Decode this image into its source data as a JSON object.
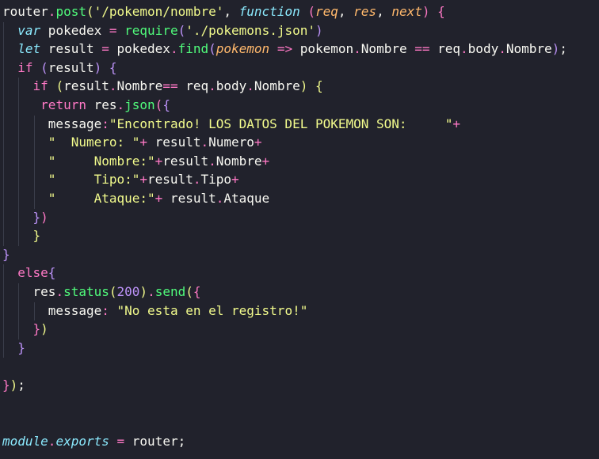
{
  "editor": {
    "lines": [
      {
        "segments": [
          {
            "t": "router",
            "c": "pu"
          },
          {
            "t": ".",
            "c": "k"
          },
          {
            "t": "post",
            "c": "fn"
          },
          {
            "t": "(",
            "c": "b1"
          },
          {
            "t": "'/pokemon/nombre'",
            "c": "s"
          },
          {
            "t": ", ",
            "c": "pu"
          },
          {
            "t": "function",
            "c": "ty"
          },
          {
            "t": " ",
            "c": "pu"
          },
          {
            "t": "(",
            "c": "b2"
          },
          {
            "t": "req",
            "c": "p"
          },
          {
            "t": ", ",
            "c": "pu"
          },
          {
            "t": "res",
            "c": "p"
          },
          {
            "t": ", ",
            "c": "pu"
          },
          {
            "t": "next",
            "c": "p"
          },
          {
            "t": ")",
            "c": "b2"
          },
          {
            "t": " ",
            "c": "pu"
          },
          {
            "t": "{",
            "c": "b2"
          }
        ]
      },
      {
        "segments": [
          {
            "t": "  ",
            "c": "pu"
          },
          {
            "t": "var",
            "c": "ty"
          },
          {
            "t": " pokedex ",
            "c": "pu"
          },
          {
            "t": "=",
            "c": "k"
          },
          {
            "t": " ",
            "c": "pu"
          },
          {
            "t": "require",
            "c": "fn"
          },
          {
            "t": "(",
            "c": "b3"
          },
          {
            "t": "'./pokemons.json'",
            "c": "s"
          },
          {
            "t": ")",
            "c": "b3"
          }
        ]
      },
      {
        "segments": [
          {
            "t": "  ",
            "c": "pu"
          },
          {
            "t": "let",
            "c": "ty"
          },
          {
            "t": " result ",
            "c": "pu"
          },
          {
            "t": "=",
            "c": "k"
          },
          {
            "t": " pokedex",
            "c": "pu"
          },
          {
            "t": ".",
            "c": "k"
          },
          {
            "t": "find",
            "c": "fn"
          },
          {
            "t": "(",
            "c": "b3"
          },
          {
            "t": "pokemon",
            "c": "p"
          },
          {
            "t": " ",
            "c": "pu"
          },
          {
            "t": "=>",
            "c": "k"
          },
          {
            "t": " pokemon",
            "c": "pu"
          },
          {
            "t": ".",
            "c": "k"
          },
          {
            "t": "Nombre ",
            "c": "pu"
          },
          {
            "t": "==",
            "c": "k"
          },
          {
            "t": " req",
            "c": "pu"
          },
          {
            "t": ".",
            "c": "k"
          },
          {
            "t": "body",
            "c": "pu"
          },
          {
            "t": ".",
            "c": "k"
          },
          {
            "t": "Nombre",
            "c": "pu"
          },
          {
            "t": ")",
            "c": "b3"
          },
          {
            "t": ";",
            "c": "pu"
          }
        ]
      },
      {
        "segments": [
          {
            "t": "  ",
            "c": "pu"
          },
          {
            "t": "if",
            "c": "k"
          },
          {
            "t": " ",
            "c": "pu"
          },
          {
            "t": "(",
            "c": "b3"
          },
          {
            "t": "result",
            "c": "pu"
          },
          {
            "t": ")",
            "c": "b3"
          },
          {
            "t": " ",
            "c": "pu"
          },
          {
            "t": "{",
            "c": "b3"
          }
        ]
      },
      {
        "segments": [
          {
            "t": "    ",
            "c": "pu"
          },
          {
            "t": "if",
            "c": "k"
          },
          {
            "t": " ",
            "c": "pu"
          },
          {
            "t": "(",
            "c": "b1"
          },
          {
            "t": "result",
            "c": "pu"
          },
          {
            "t": ".",
            "c": "k"
          },
          {
            "t": "Nombre",
            "c": "pu"
          },
          {
            "t": "==",
            "c": "k"
          },
          {
            "t": " req",
            "c": "pu"
          },
          {
            "t": ".",
            "c": "k"
          },
          {
            "t": "body",
            "c": "pu"
          },
          {
            "t": ".",
            "c": "k"
          },
          {
            "t": "Nombre",
            "c": "pu"
          },
          {
            "t": ")",
            "c": "b1"
          },
          {
            "t": " ",
            "c": "pu"
          },
          {
            "t": "{",
            "c": "b1"
          }
        ]
      },
      {
        "segments": [
          {
            "t": "     ",
            "c": "pu"
          },
          {
            "t": "return",
            "c": "k"
          },
          {
            "t": " res",
            "c": "pu"
          },
          {
            "t": ".",
            "c": "k"
          },
          {
            "t": "json",
            "c": "fn"
          },
          {
            "t": "(",
            "c": "b2"
          },
          {
            "t": "{",
            "c": "b3"
          }
        ]
      },
      {
        "segments": [
          {
            "t": "      message",
            "c": "pu"
          },
          {
            "t": ":",
            "c": "k"
          },
          {
            "t": "\"Encontrado! LOS DATOS DEL POKEMON SON:     \"",
            "c": "s"
          },
          {
            "t": "+",
            "c": "k"
          }
        ]
      },
      {
        "segments": [
          {
            "t": "      ",
            "c": "pu"
          },
          {
            "t": "\"  Numero: \"",
            "c": "s"
          },
          {
            "t": "+",
            "c": "k"
          },
          {
            "t": " result",
            "c": "pu"
          },
          {
            "t": ".",
            "c": "k"
          },
          {
            "t": "Numero",
            "c": "pu"
          },
          {
            "t": "+",
            "c": "k"
          }
        ]
      },
      {
        "segments": [
          {
            "t": "      ",
            "c": "pu"
          },
          {
            "t": "\"     Nombre:\"",
            "c": "s"
          },
          {
            "t": "+",
            "c": "k"
          },
          {
            "t": "result",
            "c": "pu"
          },
          {
            "t": ".",
            "c": "k"
          },
          {
            "t": "Nombre",
            "c": "pu"
          },
          {
            "t": "+",
            "c": "k"
          }
        ]
      },
      {
        "segments": [
          {
            "t": "      ",
            "c": "pu"
          },
          {
            "t": "\"     Tipo:\"",
            "c": "s"
          },
          {
            "t": "+",
            "c": "k"
          },
          {
            "t": "result",
            "c": "pu"
          },
          {
            "t": ".",
            "c": "k"
          },
          {
            "t": "Tipo",
            "c": "pu"
          },
          {
            "t": "+",
            "c": "k"
          }
        ]
      },
      {
        "segments": [
          {
            "t": "      ",
            "c": "pu"
          },
          {
            "t": "\"     Ataque:\"",
            "c": "s"
          },
          {
            "t": "+",
            "c": "k"
          },
          {
            "t": " result",
            "c": "pu"
          },
          {
            "t": ".",
            "c": "k"
          },
          {
            "t": "Ataque",
            "c": "pu"
          }
        ]
      },
      {
        "segments": [
          {
            "t": "    ",
            "c": "pu"
          },
          {
            "t": "}",
            "c": "b3"
          },
          {
            "t": ")",
            "c": "b2"
          }
        ]
      },
      {
        "segments": [
          {
            "t": "    ",
            "c": "pu"
          },
          {
            "t": "}",
            "c": "b1"
          }
        ]
      },
      {
        "segments": [
          {
            "t": "}",
            "c": "b3"
          }
        ]
      },
      {
        "segments": [
          {
            "t": "  ",
            "c": "pu"
          },
          {
            "t": "else",
            "c": "k"
          },
          {
            "t": "{",
            "c": "b3"
          }
        ]
      },
      {
        "segments": [
          {
            "t": "    res",
            "c": "pu"
          },
          {
            "t": ".",
            "c": "k"
          },
          {
            "t": "status",
            "c": "fn"
          },
          {
            "t": "(",
            "c": "b1"
          },
          {
            "t": "200",
            "c": "num"
          },
          {
            "t": ")",
            "c": "b1"
          },
          {
            "t": ".",
            "c": "k"
          },
          {
            "t": "send",
            "c": "fn"
          },
          {
            "t": "(",
            "c": "b1"
          },
          {
            "t": "{",
            "c": "b2"
          }
        ]
      },
      {
        "segments": [
          {
            "t": "      message",
            "c": "pu"
          },
          {
            "t": ":",
            "c": "k"
          },
          {
            "t": " ",
            "c": "pu"
          },
          {
            "t": "\"No esta en el registro!\"",
            "c": "s"
          }
        ]
      },
      {
        "segments": [
          {
            "t": "    ",
            "c": "pu"
          },
          {
            "t": "}",
            "c": "b2"
          },
          {
            "t": ")",
            "c": "b1"
          }
        ]
      },
      {
        "segments": [
          {
            "t": "  ",
            "c": "pu"
          },
          {
            "t": "}",
            "c": "b3"
          }
        ]
      },
      {
        "segments": []
      },
      {
        "segments": [
          {
            "t": "}",
            "c": "b2"
          },
          {
            "t": ")",
            "c": "b1"
          },
          {
            "t": ";",
            "c": "pu"
          }
        ]
      },
      {
        "segments": []
      },
      {
        "segments": []
      },
      {
        "segments": [
          {
            "t": "module",
            "c": "ty"
          },
          {
            "t": ".",
            "c": "k"
          },
          {
            "t": "exports",
            "c": "ty"
          },
          {
            "t": " ",
            "c": "pu"
          },
          {
            "t": "=",
            "c": "k"
          },
          {
            "t": " router",
            "c": "pu"
          },
          {
            "t": ";",
            "c": "pu"
          }
        ]
      }
    ]
  }
}
